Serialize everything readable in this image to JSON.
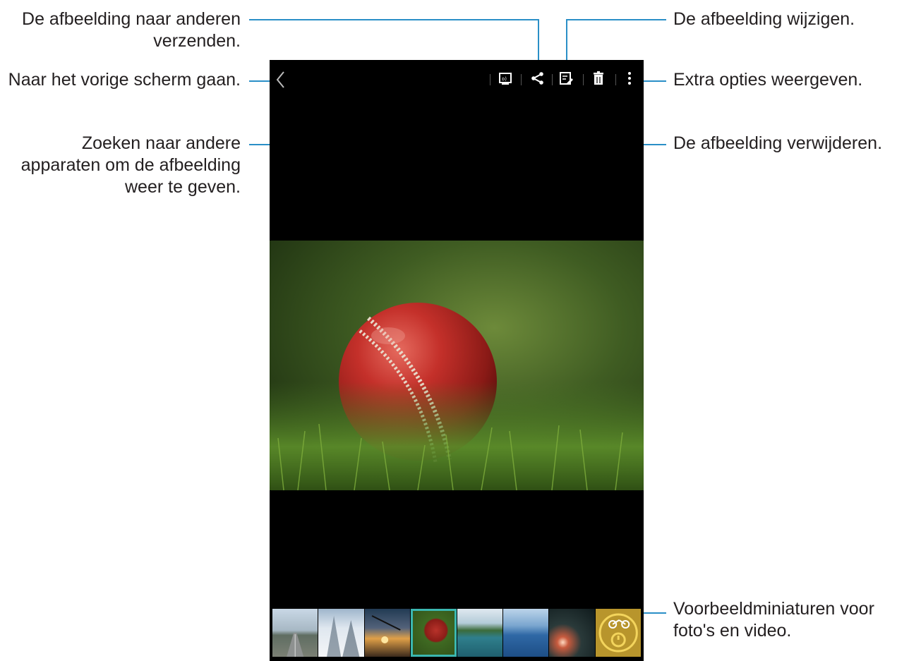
{
  "callouts": {
    "send": {
      "line1": "De afbeelding naar anderen",
      "line2": "verzenden."
    },
    "back": "Naar het vorige scherm gaan.",
    "search_devices": {
      "line1": "Zoeken naar andere",
      "line2": "apparaten om de afbeelding",
      "line3": "weer te geven."
    },
    "edit": "De afbeelding wijzigen.",
    "more": "Extra opties weergeven.",
    "delete": "De afbeelding verwijderen.",
    "thumbnails": {
      "line1": "Voorbeeldminiaturen voor",
      "line2": "foto's en video."
    }
  },
  "toolbar": {
    "icons": [
      "back-icon",
      "screen-mirror-icon",
      "share-icon",
      "edit-icon",
      "trash-icon",
      "more-icon"
    ]
  },
  "main_image": "cricket-ball-on-grass",
  "thumbnails": [
    "highway",
    "snowy-trees",
    "sunset-boat",
    "cricket-ball",
    "lake-island",
    "blue-sea",
    "road-lights",
    "video-bicycle"
  ],
  "colors": {
    "leader_line": "#2a8fc7",
    "screen_bg": "#000000",
    "selected_thumb": "#3bb7b0"
  }
}
